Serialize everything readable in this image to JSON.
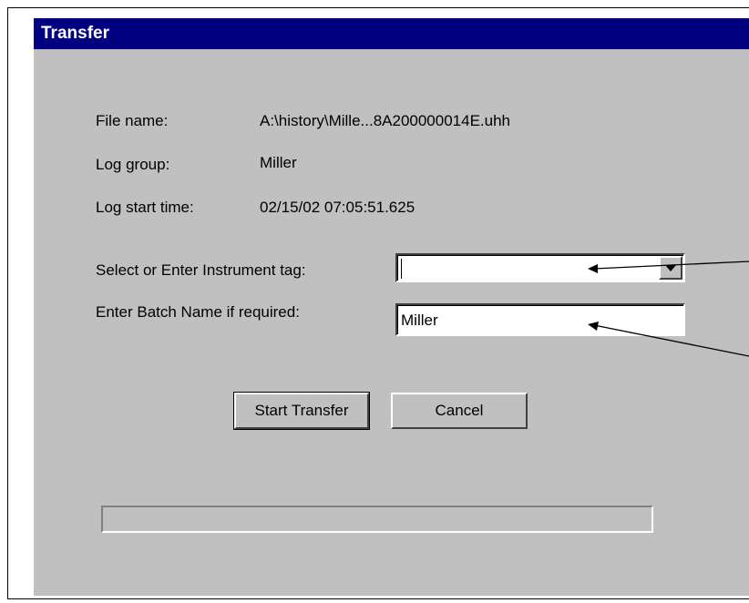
{
  "dialog": {
    "title": "Transfer"
  },
  "info": {
    "file_name_label": "File name:",
    "file_name_value": "A:\\history\\Mille...8A200000014E.uhh",
    "log_group_label": "Log group:",
    "log_group_value": "Miller",
    "log_start_label": "Log start time:",
    "log_start_value": "02/15/02 07:05:51.625"
  },
  "form": {
    "instrument_label": "Select or Enter Instrument tag:",
    "instrument_value": "",
    "batch_label": "Enter Batch Name if required:",
    "batch_value": "Miller"
  },
  "buttons": {
    "start_label": "Start Transfer",
    "cancel_label": "Cancel"
  },
  "progress": {
    "fraction": 0
  },
  "colors": {
    "title_bar": "#000080",
    "dialog_face": "#c0c0c0"
  }
}
